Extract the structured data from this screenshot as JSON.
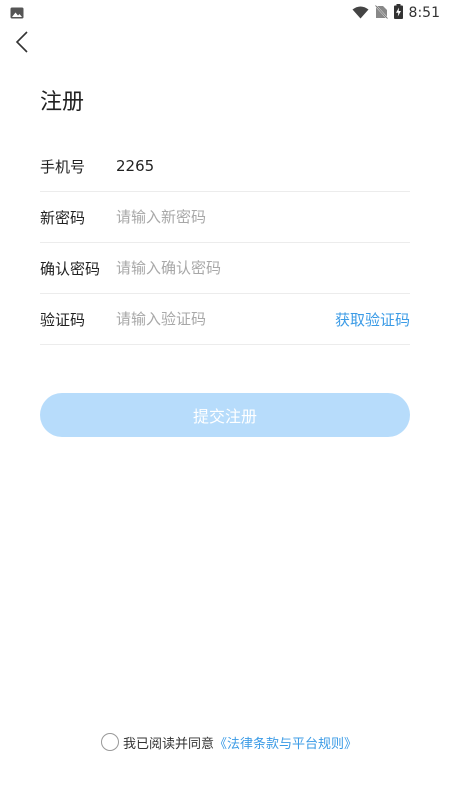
{
  "status_bar": {
    "time": "8:51",
    "icons": [
      "image-icon",
      "wifi-icon",
      "no-sim-icon",
      "battery-charging-icon"
    ]
  },
  "header": {
    "back_icon": "chevron-left-icon",
    "title": "注册"
  },
  "form": {
    "phone": {
      "label": "手机号",
      "value": "2265"
    },
    "new_password": {
      "label": "新密码",
      "placeholder": "请输入新密码"
    },
    "confirm_password": {
      "label": "确认密码",
      "placeholder": "请输入确认密码"
    },
    "verification": {
      "label": "验证码",
      "placeholder": "请输入验证码",
      "action": "获取验证码"
    }
  },
  "submit": {
    "label": "提交注册"
  },
  "agreement": {
    "text": "我已阅读并同意",
    "link": "《法律条款与平台规则》"
  },
  "colors": {
    "accent": "#3b9be6",
    "button_disabled": "#b7dcfb",
    "divider": "#ececec",
    "placeholder": "#a8a8a8"
  }
}
